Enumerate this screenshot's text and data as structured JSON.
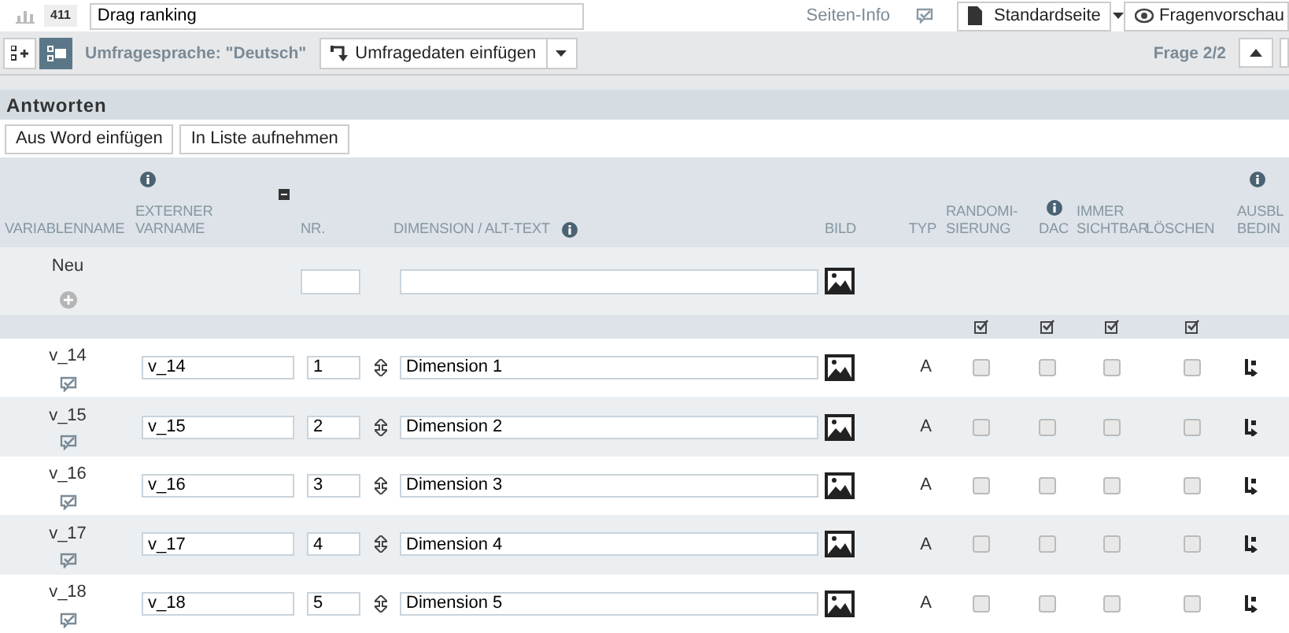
{
  "header": {
    "question_number": "411",
    "question_title": "Drag ranking",
    "page_info_label": "Seiten-Info",
    "page_type": "Standardseite",
    "preview_label": "Fragenvorschau"
  },
  "toolbar": {
    "view_toggles": [
      {
        "kind": "add",
        "selected": false
      },
      {
        "kind": "list",
        "selected": true
      }
    ],
    "language_label": "Umfragesprache: \"Deutsch\"",
    "insert_button": "Umfragedaten einfügen",
    "question_counter": "Frage 2/2"
  },
  "section": {
    "title": "Antworten",
    "buttons": [
      "Aus Word einfügen",
      "In Liste aufnehmen"
    ]
  },
  "table": {
    "columns": [
      {
        "lines": [
          "VARIABLENNAME"
        ]
      },
      {
        "lines": [
          "EXTERNER",
          "VARNAME"
        ],
        "info_above": true
      },
      {
        "lines": [
          "NR."
        ],
        "collapse_toggle": true
      },
      {
        "lines": [
          "DIMENSION / ALT-TEXT"
        ],
        "info_inline": true
      },
      {
        "lines": [
          "BILD"
        ]
      },
      {
        "lines": [
          "TYP"
        ]
      },
      {
        "lines": [
          "RANDOMI-",
          "SIERUNG"
        ]
      },
      {
        "lines": [
          "DAC"
        ],
        "info_above": true
      },
      {
        "lines": [
          "IMMER",
          "SICHTBAR"
        ]
      },
      {
        "lines": [
          "LÖSCHEN"
        ]
      },
      {
        "lines": [
          "AUSBL",
          "BEDIN"
        ],
        "info_above": true
      }
    ],
    "new_row": {
      "label": "Neu"
    },
    "rows": [
      {
        "variable": "v_14",
        "external": "v_14",
        "nr": "1",
        "dimension": "Dimension 1",
        "type": "A",
        "randomization": false,
        "dac": false,
        "always_visible": false,
        "delete": false
      },
      {
        "variable": "v_15",
        "external": "v_15",
        "nr": "2",
        "dimension": "Dimension 2",
        "type": "A",
        "randomization": false,
        "dac": false,
        "always_visible": false,
        "delete": false
      },
      {
        "variable": "v_16",
        "external": "v_16",
        "nr": "3",
        "dimension": "Dimension 3",
        "type": "A",
        "randomization": false,
        "dac": false,
        "always_visible": false,
        "delete": false
      },
      {
        "variable": "v_17",
        "external": "v_17",
        "nr": "4",
        "dimension": "Dimension 4",
        "type": "A",
        "randomization": false,
        "dac": false,
        "always_visible": false,
        "delete": false
      },
      {
        "variable": "v_18",
        "external": "v_18",
        "nr": "5",
        "dimension": "Dimension 5",
        "type": "A",
        "randomization": false,
        "dac": false,
        "always_visible": false,
        "delete": false
      }
    ]
  }
}
